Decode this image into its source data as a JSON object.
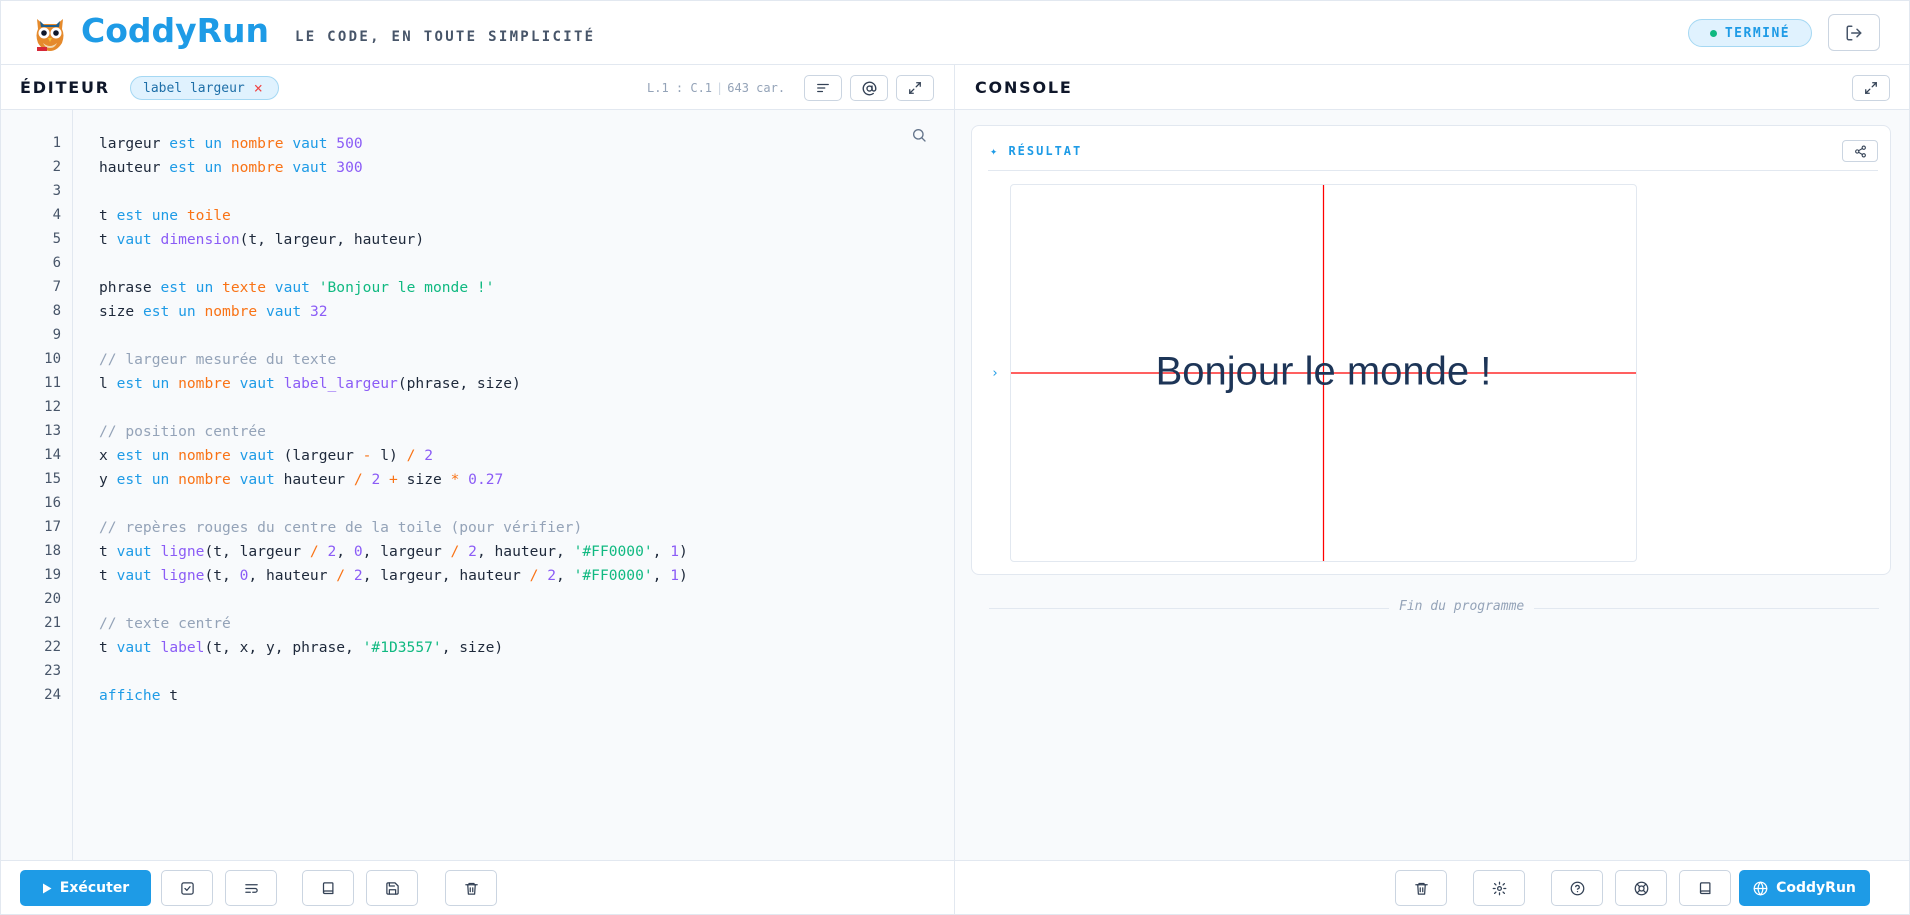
{
  "header": {
    "brand": "CoddyRun",
    "tagline": "LE CODE, EN TOUTE SIMPLICITÉ",
    "status": "TERMINÉ",
    "logo_icon": "owl-logo-icon",
    "logout_icon": "logout-icon"
  },
  "editor": {
    "title": "ÉDITEUR",
    "chip_label": "label largeur",
    "chip_close": "×",
    "cursor": "L.1 : C.1",
    "char_count": "643 car.",
    "toolbar_icons": [
      "format-icon",
      "at-icon",
      "expand-icon"
    ],
    "line_numbers": [
      "1",
      "2",
      "3",
      "4",
      "5",
      "6",
      "7",
      "8",
      "9",
      "10",
      "11",
      "12",
      "13",
      "14",
      "15",
      "16",
      "17",
      "18",
      "19",
      "20",
      "21",
      "22",
      "23",
      "24"
    ],
    "code_lines": [
      "largeur est un nombre vaut 500",
      "hauteur est un nombre vaut 300",
      "",
      "t est une toile",
      "t vaut dimension(t, largeur, hauteur)",
      "",
      "phrase est un texte vaut 'Bonjour le monde !'",
      "size est un nombre vaut 32",
      "",
      "// largeur mesurée du texte",
      "l est un nombre vaut label_largeur(phrase, size)",
      "",
      "// position centrée",
      "x est un nombre vaut (largeur - l) / 2",
      "y est un nombre vaut hauteur / 2 + size * 0.27",
      "",
      "// repères rouges du centre de la toile (pour vérifier)",
      "t vaut ligne(t, largeur / 2, 0, largeur / 2, hauteur, '#FF0000', 1)",
      "t vaut ligne(t, 0, hauteur / 2, largeur, hauteur / 2, '#FF0000', 1)",
      "",
      "// texte centré",
      "t vaut label(t, x, y, phrase, '#1D3557', size)",
      "",
      "affiche t"
    ],
    "footer": {
      "run_label": "Exécuter",
      "buttons": [
        "check-icon",
        "wrap-icon",
        "book-icon",
        "save-icon",
        "trash-icon"
      ]
    }
  },
  "console": {
    "title": "CONSOLE",
    "result_label": "✦ RÉSULTAT",
    "prompt": "›",
    "canvas": {
      "width": 500,
      "height": 300,
      "text": "Bonjour le monde !",
      "text_color": "#1D3557",
      "line_color": "#FF0000",
      "font_size": 32
    },
    "end_text": "Fin du programme",
    "footer": {
      "buttons": [
        "trash-icon",
        "gear-icon",
        "help-icon",
        "lifebuoy-icon",
        "book-icon"
      ],
      "brand_label": "CoddyRun"
    }
  },
  "colors": {
    "accent": "#1e9be6",
    "keyword": "#1e9be6",
    "type": "#f97316",
    "number": "#8b5cf6",
    "string": "#10b981",
    "comment": "#94a3b8"
  }
}
